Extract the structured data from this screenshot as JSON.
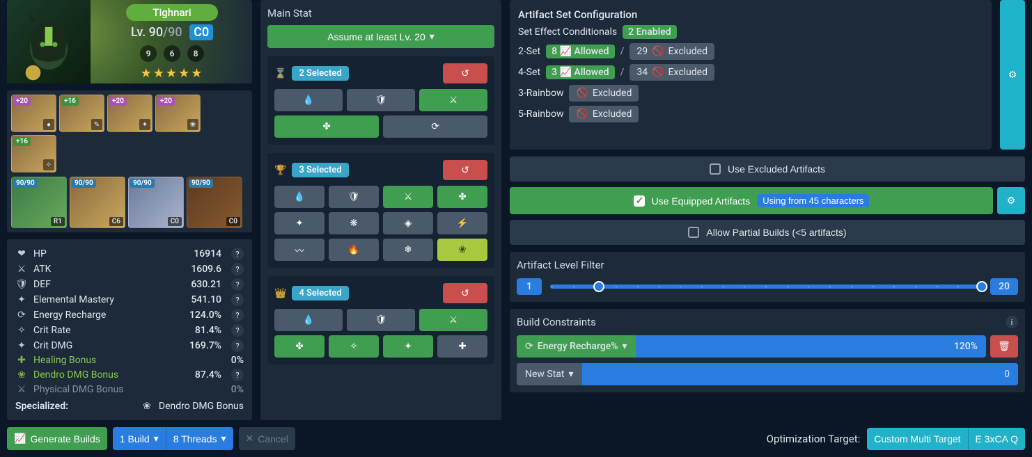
{
  "character": {
    "name": "Tighnari",
    "level_label": "Lv. 90",
    "level_cap": "/90",
    "constellation": "C0",
    "talents": [
      "9",
      "6",
      "8"
    ],
    "stars": "★★★★★"
  },
  "equipment": {
    "artifacts": [
      {
        "badge": "+20",
        "badgeClass": "b-purple"
      },
      {
        "badge": "+16",
        "badgeClass": "b-green"
      },
      {
        "badge": "+20",
        "badgeClass": "b-purple"
      },
      {
        "badge": "+20",
        "badgeClass": "b-purple"
      },
      {
        "badge": "+16",
        "badgeClass": "b-green"
      }
    ],
    "weapon": {
      "badge": "90/90",
      "sub": "R1"
    },
    "team": [
      {
        "badge": "90/90",
        "sub": "C6"
      },
      {
        "badge": "90/90",
        "sub": "C0"
      },
      {
        "badge": "90/90",
        "sub": "C0"
      }
    ]
  },
  "stats": [
    {
      "icon": "❤",
      "label": "HP",
      "value": "16914"
    },
    {
      "icon": "⚔",
      "label": "ATK",
      "value": "1609.6"
    },
    {
      "icon": "🛡",
      "label": "DEF",
      "value": "630.21"
    },
    {
      "icon": "✦",
      "label": "Elemental Mastery",
      "value": "541.10"
    },
    {
      "icon": "⟳",
      "label": "Energy Recharge",
      "value": "124.0%"
    },
    {
      "icon": "✧",
      "label": "Crit Rate",
      "value": "81.4%"
    },
    {
      "icon": "✦",
      "label": "Crit DMG",
      "value": "169.7%"
    },
    {
      "icon": "✚",
      "label": "Healing Bonus",
      "value": "0%",
      "green": true,
      "nohelp": true
    },
    {
      "icon": "❀",
      "label": "Dendro DMG Bonus",
      "value": "87.4%",
      "green": true
    },
    {
      "icon": "⚔",
      "label": "Physical DMG Bonus",
      "value": "0%",
      "dim": true,
      "nohelp": true
    }
  ],
  "specialized": {
    "label": "Specialized:",
    "value": "Dendro DMG Bonus"
  },
  "mainstat": {
    "title": "Main Stat",
    "assume_label": "Assume at least Lv. 20",
    "sands": {
      "chip": "2 Selected"
    },
    "goblet": {
      "chip": "3 Selected"
    },
    "circlet": {
      "chip": "4 Selected"
    }
  },
  "artifact_config": {
    "title": "Artifact Set Configuration",
    "conditionals_label": "Set Effect Conditionals",
    "conditionals_badge": "2 Enabled",
    "two_set_label": "2-Set",
    "two_set_allowed": "8",
    "two_set_allowed_text": "Allowed",
    "two_set_excluded": "29",
    "two_set_excluded_text": "Excluded",
    "four_set_label": "4-Set",
    "four_set_allowed": "3",
    "four_set_allowed_text": "Allowed",
    "four_set_excluded": "34",
    "four_set_excluded_text": "Excluded",
    "three_rainbow_label": "3-Rainbow",
    "three_rainbow_state": "Excluded",
    "five_rainbow_label": "5-Rainbow",
    "five_rainbow_state": "Excluded"
  },
  "options": {
    "use_excluded": "Use Excluded Artifacts",
    "use_equipped": "Use Equipped Artifacts",
    "use_equipped_badge": "Using from 45 characters",
    "allow_partial": "Allow Partial Builds (<5 artifacts)"
  },
  "level_filter": {
    "title": "Artifact Level Filter",
    "min": "1",
    "max": "20"
  },
  "constraints": {
    "title": "Build Constraints",
    "row_label": "Energy Recharge%",
    "row_value": "120%",
    "new_label": "New Stat",
    "new_value": "0"
  },
  "footer": {
    "generate": "Generate Builds",
    "builds": "1 Build",
    "threads": "8 Threads",
    "cancel": "Cancel",
    "opt_label": "Optimization Target:",
    "target1": "Custom Multi Target",
    "target2": "E 3xCA Q"
  }
}
